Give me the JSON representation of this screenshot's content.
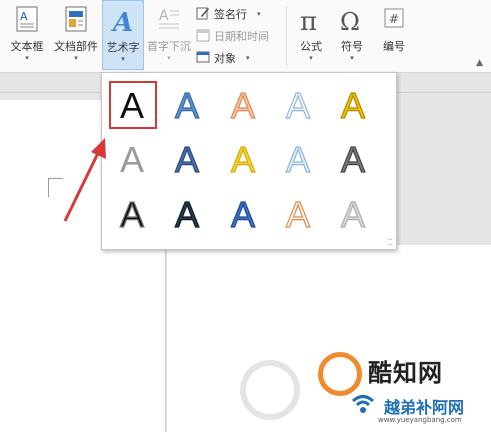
{
  "ribbon": {
    "text_box": {
      "label": "文本框"
    },
    "quick_parts": {
      "label": "文档部件"
    },
    "wordart": {
      "label": "艺术字"
    },
    "drop_cap": {
      "label": "首字下沉"
    },
    "signature_line": {
      "label": "签名行"
    },
    "date_time": {
      "label": "日期和时间"
    },
    "object": {
      "label": "对象"
    },
    "equation": {
      "label": "公式"
    },
    "symbol": {
      "label": "符号"
    },
    "number": {
      "label": "编号"
    },
    "dropdown_glyph": "▾"
  },
  "wordart_gallery": {
    "glyph": "A",
    "selected_index": 0,
    "styles": [
      {
        "fill": "#111111",
        "stroke": "none"
      },
      {
        "fill": "#5b8fd0",
        "stroke": "#3a6aa8"
      },
      {
        "fill": "#f3c6a5",
        "stroke": "#e08a55"
      },
      {
        "fill": "#ffffff",
        "stroke": "#8fb3d9"
      },
      {
        "fill": "#f0c200",
        "stroke": "#b08a00"
      },
      {
        "fill": "#9a9a9a",
        "stroke": "none"
      },
      {
        "fill": "#4a6ea8",
        "stroke": "#2c4c80"
      },
      {
        "fill": "#f7d33b",
        "stroke": "#d9a900"
      },
      {
        "fill": "#dfeef7",
        "stroke": "#8cb7d4"
      },
      {
        "fill": "#7a7a7a",
        "stroke": "#444444"
      },
      {
        "fill": "#111111",
        "stroke": "#777777"
      },
      {
        "fill": "#25384e",
        "stroke": "#0e1a28"
      },
      {
        "fill": "#3b6fc4",
        "stroke": "#1e4c99"
      },
      {
        "fill": "#ffffff",
        "stroke": "#e08a45"
      },
      {
        "fill": "#d8d8d8",
        "stroke": "#b0b0b0"
      }
    ]
  },
  "watermark": {
    "name": "酷知网",
    "cn": "越弟补阿网",
    "url": "www.yueyangbang.com"
  }
}
